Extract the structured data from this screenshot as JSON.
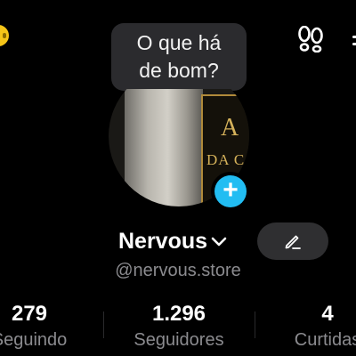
{
  "status_bubble": {
    "line1": "O que há",
    "line2": "de bom?"
  },
  "avatar": {
    "poster_line1": "A",
    "poster_line2": "DA C"
  },
  "profile": {
    "name": "Nervous",
    "handle": "@nervous.store"
  },
  "stats": [
    {
      "value": "279",
      "label": "Seguindo"
    },
    {
      "value": "1.296",
      "label": "Seguidores"
    },
    {
      "value": "4",
      "label": "Curtidas"
    }
  ],
  "colors": {
    "background": "#000000",
    "accent": "#22bdf2",
    "muted_text": "#8b8b8f",
    "button_bg": "#2f2f31",
    "coin": "#f5c518"
  },
  "icons": [
    "coin-icon",
    "footprints-icon",
    "menu-icon",
    "plus-icon",
    "chevron-down-icon",
    "pencil-icon"
  ]
}
